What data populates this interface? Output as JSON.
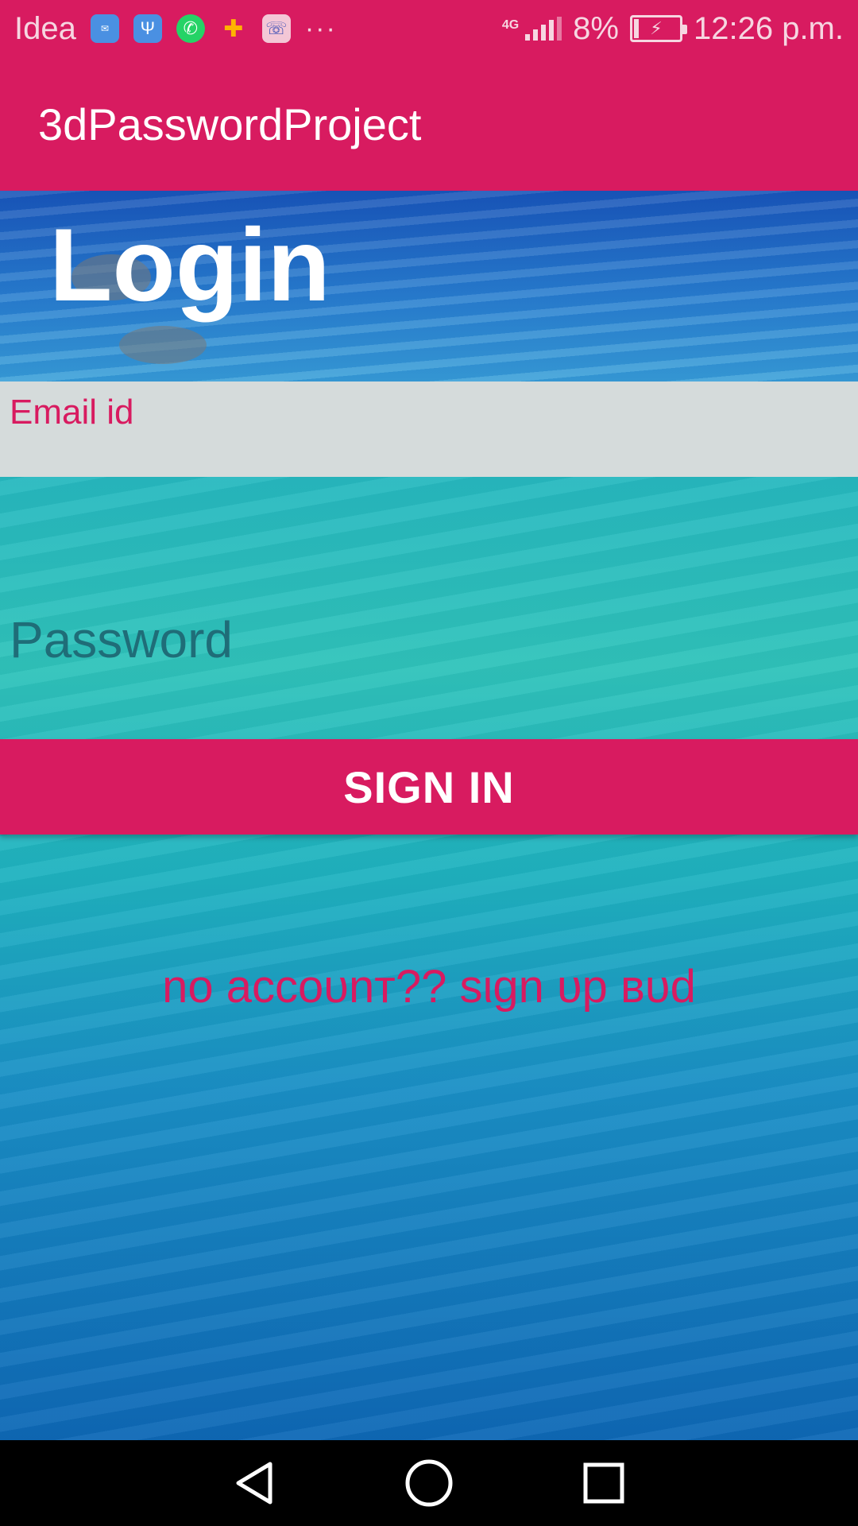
{
  "status_bar": {
    "carrier": "Idea",
    "notification_icons": [
      "email-icon",
      "usb-icon",
      "whatsapp-icon",
      "puzzle-icon",
      "phone-icon"
    ],
    "more": "···",
    "network": "4G",
    "battery": "8%",
    "time": "12:26 p.m."
  },
  "app_bar": {
    "title": "3dPasswordProject"
  },
  "login": {
    "heading": "Login",
    "email_label": "Email id",
    "password_placeholder": "Password",
    "sign_in_label": "SIGN IN",
    "signup_text": "no accoυnт?? sιgn υp вυd"
  },
  "nav_bar": {
    "icons": [
      "back-icon",
      "home-icon",
      "recents-icon"
    ]
  },
  "colors": {
    "accent": "#d81b60",
    "field_bg": "#d5dbdb",
    "nav_bg": "#000000"
  }
}
